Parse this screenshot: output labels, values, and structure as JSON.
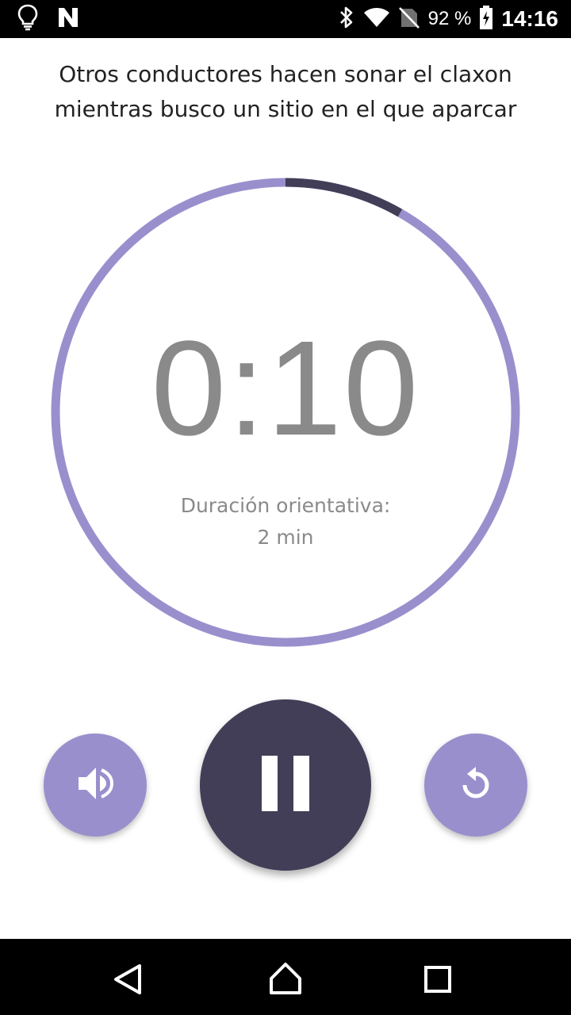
{
  "status_bar": {
    "icons_left": [
      "lightbulb-icon",
      "n-logo-icon"
    ],
    "icons_right": [
      "bluetooth-icon",
      "wifi-icon",
      "no-sim-icon",
      "battery-charging-icon"
    ],
    "battery_percent": "92 %",
    "time": "14:16"
  },
  "title": {
    "line1": "Otros conductores hacen sonar el claxon",
    "line2": "mientras busco un sitio en el que aparcar"
  },
  "timer": {
    "time": "0:10",
    "duration_label": "Duración orientativa:",
    "duration_value": "2 min",
    "elapsed_fraction": 0.083
  },
  "controls": {
    "sound_icon": "volume-icon",
    "pause_icon": "pause-icon",
    "reset_icon": "replay-icon"
  },
  "nav_bar": {
    "icons": [
      "back-icon",
      "home-icon",
      "recents-icon"
    ]
  },
  "colors": {
    "ring_track": "#9a8fcd",
    "ring_progress": "#433e57",
    "accent_light": "#9a8fcd",
    "accent_dark": "#433e57",
    "timer_text": "#8a8a8a"
  }
}
